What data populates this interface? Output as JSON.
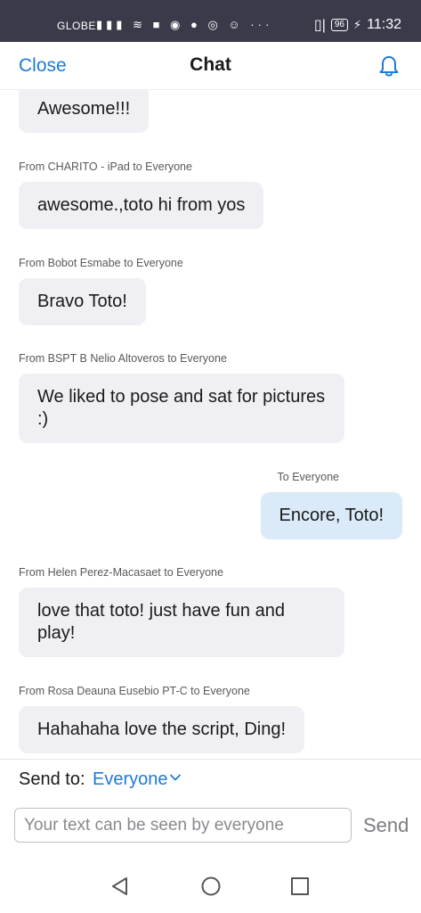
{
  "status": {
    "carrier": "GLOBE",
    "icons": "▮▮▮ ≋ ■ ◉ ● ◎ ☺ ···",
    "right_icons": "▯|",
    "battery": "96",
    "charging": "⚡",
    "time": "11:32"
  },
  "header": {
    "close_label": "Close",
    "title": "Chat",
    "bell_icon": "bell-icon"
  },
  "messages": [
    {
      "sender": "",
      "text": "Awesome!!!",
      "mine": false
    },
    {
      "sender": "From CHARITO - iPad  to Everyone",
      "text": "awesome.,toto hi from yos",
      "mine": false
    },
    {
      "sender": "From Bobot Esmabe to Everyone",
      "text": "Bravo Toto!",
      "mine": false
    },
    {
      "sender": "From BSPT B Nelio Altoveros to Everyone",
      "text": "We liked to pose and sat for pictures :)",
      "mine": false
    },
    {
      "sender": "To Everyone",
      "text": "Encore, Toto!",
      "mine": true
    },
    {
      "sender": "From Helen Perez-Macasaet to Everyone",
      "text": "love that toto! just have fun and play!",
      "mine": false
    },
    {
      "sender": "From Rosa Deauna Eusebio PT-C to Everyone",
      "text": "Hahahaha love the script, Ding!",
      "mine": false
    }
  ],
  "footer": {
    "send_to_label": "Send to:",
    "send_to_value": "Everyone",
    "input_placeholder": "Your text can be seen by everyone",
    "input_value": "",
    "send_label": "Send"
  },
  "nav": {
    "back_icon": "back-triangle-icon",
    "home_icon": "home-circle-icon",
    "recents_icon": "recents-square-icon"
  },
  "colors": {
    "accent": "#1e7ad6",
    "status_bar": "#3a3b4a",
    "bubble_other": "#f0f0f4",
    "bubble_mine": "#daeaf8"
  }
}
